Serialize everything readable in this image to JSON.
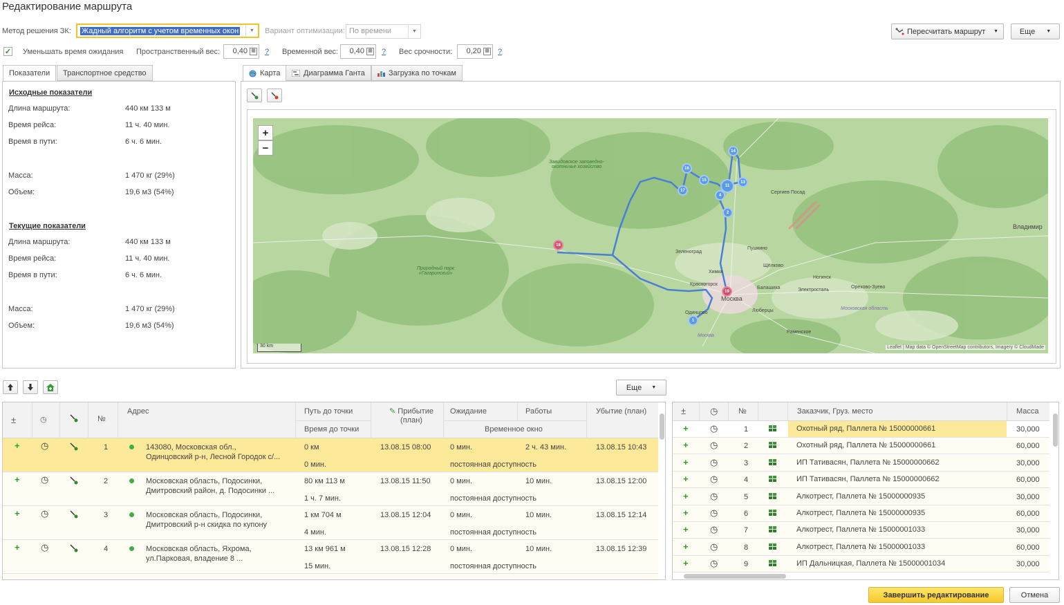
{
  "window": {
    "title": "Редактирование маршрута"
  },
  "params": {
    "method_label": "Метод решения ЗК:",
    "method_value": "Жадный алгоритм с учетом временных окон",
    "optimization_label": "Вариант оптимизации:",
    "optimization_value": "По времени",
    "reduce_wait_label": "Уменьшать время ожидания",
    "reduce_wait_checked": true,
    "spatial_weight_label": "Пространственный вес:",
    "spatial_weight_value": "0,40",
    "time_weight_label": "Временной вес:",
    "time_weight_value": "0,40",
    "urgency_weight_label": "Вес срочности:",
    "urgency_weight_value": "0,20",
    "help": "?"
  },
  "toolbar": {
    "recalc_label": "Пересчитать маршрут",
    "more_label": "Еще"
  },
  "left_tabs": [
    {
      "label": "Показатели"
    },
    {
      "label": "Транспортное средство"
    }
  ],
  "indicators": {
    "initial_title": "Исходные показатели",
    "current_title": "Текущие показатели",
    "initial": [
      {
        "k": "Длина маршрута:",
        "v": "440 км 133 м"
      },
      {
        "k": "Время рейса:",
        "v": "11 ч. 40 мин."
      },
      {
        "k": "Время в пути:",
        "v": "6 ч. 6 мин."
      },
      {
        "k": "Масса:",
        "v": "1 470 кг (29%)"
      },
      {
        "k": "Объем:",
        "v": "19,6 м3 (54%)"
      }
    ],
    "current": [
      {
        "k": "Длина маршрута:",
        "v": "440 км 133 м"
      },
      {
        "k": "Время рейса:",
        "v": "11 ч. 40 мин."
      },
      {
        "k": "Время в пути:",
        "v": "6 ч. 6 мин."
      },
      {
        "k": "Масса:",
        "v": "1 470 кг (29%)"
      },
      {
        "k": "Объем:",
        "v": "19,6 м3 (54%)"
      }
    ]
  },
  "right_tabs": [
    {
      "label": "Карта"
    },
    {
      "label": "Диаграмма Ганта"
    },
    {
      "label": "Загрузка по точкам"
    }
  ],
  "map": {
    "zoom_in": "+",
    "zoom_out": "−",
    "scale_label": "30 km",
    "attribution": "Leaflet | Map data © OpenStreetMap contributors, Imagery © CloudMade",
    "area_labels": [
      "Завидовское заповедно-охотничье хозяйство",
      "Природный парк «Гагаринский»"
    ],
    "cities": [
      "Сергиев Посад",
      "Владимир",
      "Зеленоград",
      "Пушкино",
      "Щёлково",
      "Химки",
      "Красногорск",
      "Москва",
      "Балашиха",
      "Ногинск",
      "Электросталь",
      "Орехово-Зуево",
      "Одинцово",
      "Люберцы",
      "Московская область",
      "Раменское",
      "Москва"
    ],
    "markers": [
      {
        "n": "14",
        "red": false
      },
      {
        "n": "16",
        "red": false
      },
      {
        "n": "15",
        "red": false
      },
      {
        "n": "11",
        "red": false
      },
      {
        "n": "13",
        "red": false
      },
      {
        "n": "17",
        "red": false
      },
      {
        "n": "4",
        "red": false
      },
      {
        "n": "2",
        "red": false
      },
      {
        "n": "18",
        "red": true
      },
      {
        "n": "19",
        "red": true
      },
      {
        "n": "1",
        "red": false
      }
    ]
  },
  "mid_toolbar": {
    "more_label": "Еще"
  },
  "route_grid": {
    "headers": {
      "addr": "Адрес",
      "path": "Путь до точки",
      "time": "Время до точки",
      "arrival": "Прибытие (план)",
      "wait": "Ожидание",
      "work": "Работы",
      "window": "Временное окно",
      "depart": "Убытие (план)",
      "num": "№",
      "pm": "±"
    },
    "rows": [
      {
        "n": "1",
        "addr1": "143080, Московская обл.,",
        "addr2": "Одинцовский р-н, Лесной Городок с/...",
        "path": "0 км",
        "time": "0 мин.",
        "arrival": "13.08.15 08:00",
        "wait": "0 мин.",
        "work": "2 ч. 43 мин.",
        "window": "постоянная доступность",
        "depart": "13.08.15 10:43"
      },
      {
        "n": "2",
        "addr1": "Московская область, Подосинки,",
        "addr2": "Дмитровский район, д. Подосинки ...",
        "path": "80 км 113 м",
        "time": "1 ч. 7 мин.",
        "arrival": "13.08.15 11:50",
        "wait": "0 мин.",
        "work": "10 мин.",
        "window": "постоянная доступность",
        "depart": "13.08.15 12:00"
      },
      {
        "n": "3",
        "addr1": "Московская область, Подосинки,",
        "addr2": "Дмитровский р-н скидка по купону",
        "path": "1 км 704 м",
        "time": "4 мин.",
        "arrival": "13.08.15 12:04",
        "wait": "0 мин.",
        "work": "10 мин.",
        "window": "постоянная доступность",
        "depart": "13.08.15 12:14"
      },
      {
        "n": "4",
        "addr1": "Московская область, Яхрома,",
        "addr2": "ул.Парковая, владение 8 ...",
        "path": "13 км 961 м",
        "time": "15 мин.",
        "arrival": "13.08.15 12:28",
        "wait": "0 мин.",
        "work": "10 мин.",
        "window": "постоянная доступность",
        "depart": "13.08.15 12:39"
      }
    ]
  },
  "cargo_grid": {
    "headers": {
      "customer": "Заказчик, Груз. место",
      "mass": "Масса",
      "num": "№",
      "pm": "±"
    },
    "rows": [
      {
        "n": "1",
        "customer": "Охотный ряд, Паллета № 15000000661",
        "mass": "30,000"
      },
      {
        "n": "2",
        "customer": "Охотный ряд, Паллета № 15000000661",
        "mass": "60,000"
      },
      {
        "n": "3",
        "customer": "ИП Тативасян, Паллета № 15000000662",
        "mass": "30,000"
      },
      {
        "n": "4",
        "customer": "ИП Тативасян, Паллета № 15000000662",
        "mass": "60,000"
      },
      {
        "n": "5",
        "customer": "Алкотрест, Паллета № 15000000935",
        "mass": "30,000"
      },
      {
        "n": "6",
        "customer": "Алкотрест, Паллета № 15000000935",
        "mass": "60,000"
      },
      {
        "n": "7",
        "customer": "Алкотрест, Паллета № 15000001033",
        "mass": "30,000"
      },
      {
        "n": "8",
        "customer": "Алкотрест, Паллета № 15000001033",
        "mass": "60,000"
      },
      {
        "n": "9",
        "customer": "ИП Дальницкая, Паллета № 15000001034",
        "mass": "30,000"
      }
    ]
  },
  "footer": {
    "finish_label": "Завершить редактирование",
    "cancel_label": "Отмена"
  },
  "colors": {
    "accent_yellow": "#f4c92c",
    "selected_row": "#fde99a",
    "route_line": "#4a7fd6",
    "marker_blue": "#5b9ae6",
    "marker_red": "#d24f6b"
  }
}
